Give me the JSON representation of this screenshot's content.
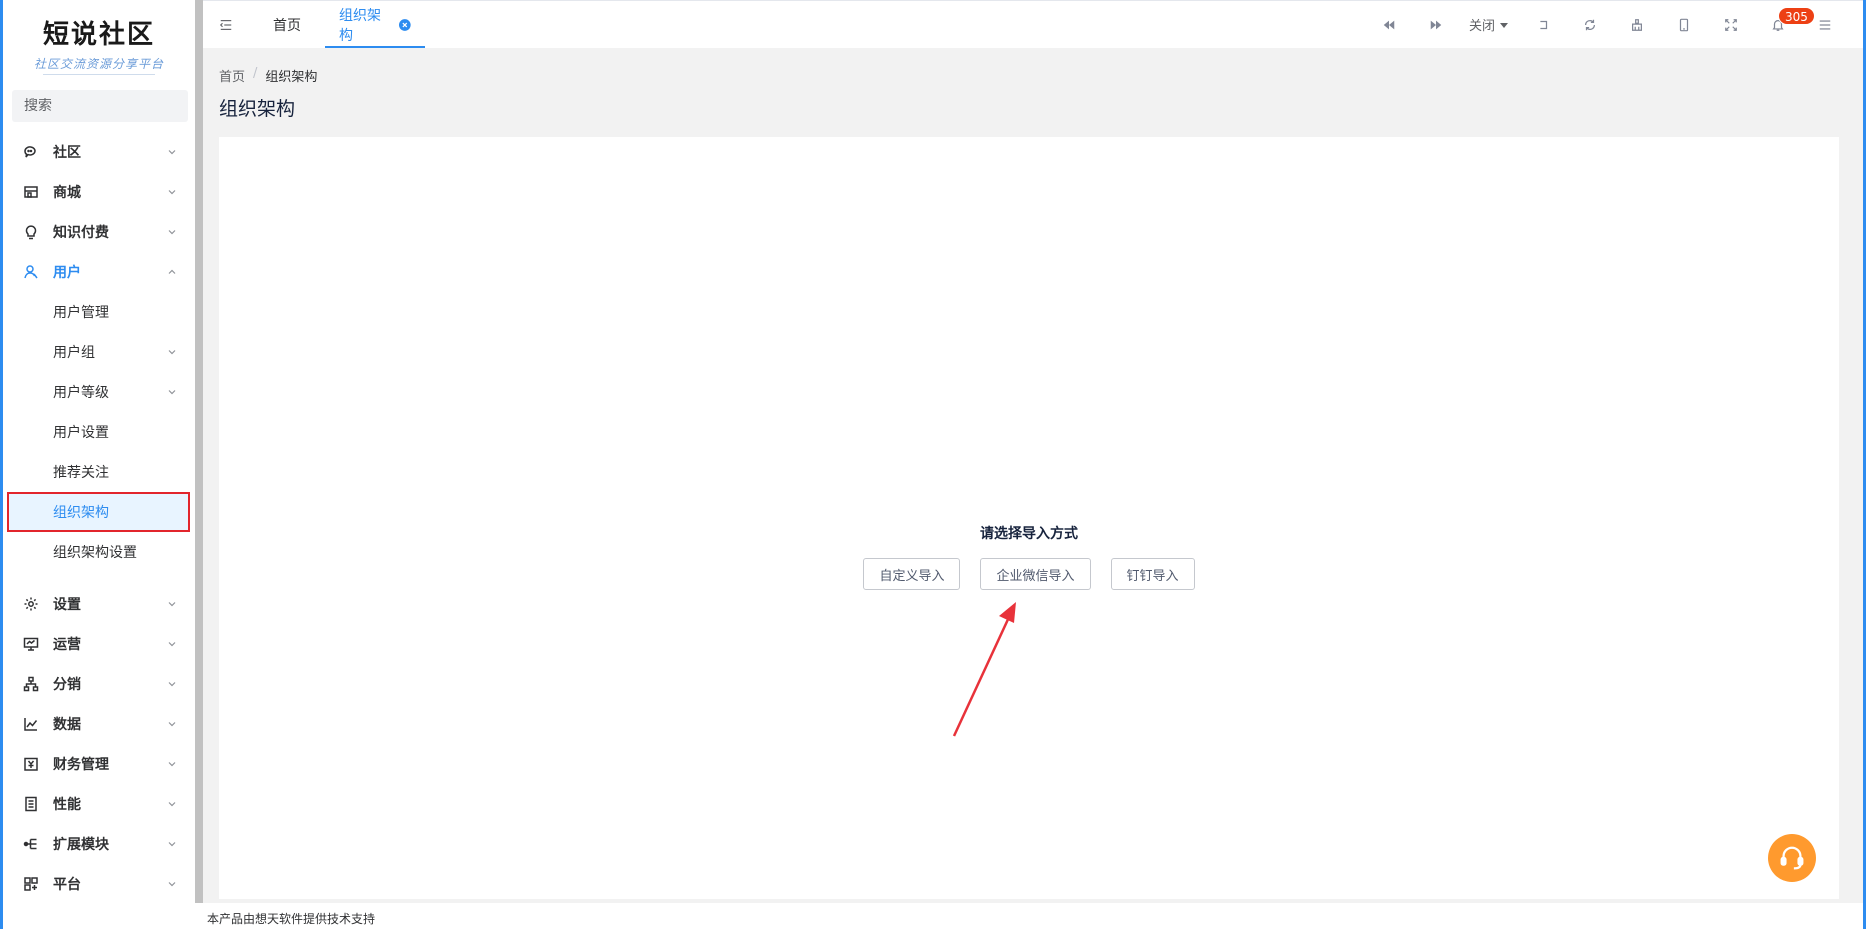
{
  "brand": {
    "title": "短说社区",
    "subtitle": "社区交流资源分享平台"
  },
  "search": {
    "placeholder": "搜索"
  },
  "sidebar": {
    "groups_top": [
      {
        "label": "社区",
        "icon": "chat-icon",
        "expanded": false
      },
      {
        "label": "商城",
        "icon": "store-icon",
        "expanded": false
      },
      {
        "label": "知识付费",
        "icon": "bulb-icon",
        "expanded": false
      },
      {
        "label": "用户",
        "icon": "user-icon",
        "expanded": true
      }
    ],
    "user_submenu": [
      {
        "label": "用户管理",
        "has_children": false
      },
      {
        "label": "用户组",
        "has_children": true
      },
      {
        "label": "用户等级",
        "has_children": true
      },
      {
        "label": "用户设置",
        "has_children": false
      },
      {
        "label": "推荐关注",
        "has_children": false
      },
      {
        "label": "组织架构",
        "has_children": false,
        "selected": true
      },
      {
        "label": "组织架构设置",
        "has_children": false
      }
    ],
    "groups_bottom": [
      {
        "label": "设置",
        "icon": "gear-icon"
      },
      {
        "label": "运营",
        "icon": "monitor-icon"
      },
      {
        "label": "分销",
        "icon": "tree-icon"
      },
      {
        "label": "数据",
        "icon": "chart-icon"
      },
      {
        "label": "财务管理",
        "icon": "finance-icon"
      },
      {
        "label": "性能",
        "icon": "performance-icon"
      },
      {
        "label": "扩展模块",
        "icon": "extension-icon"
      },
      {
        "label": "平台",
        "icon": "platform-icon"
      }
    ]
  },
  "tabs": [
    {
      "label": "首页",
      "active": false
    },
    {
      "label": "组织架构",
      "active": true,
      "closable": true
    }
  ],
  "toolbar": {
    "close_label": "关闭",
    "notification_count": "305"
  },
  "breadcrumb": {
    "home": "首页",
    "separator": "/",
    "current": "组织架构"
  },
  "page": {
    "title": "组织架构",
    "prompt": "请选择导入方式",
    "buttons": [
      "自定义导入",
      "企业微信导入",
      "钉钉导入"
    ]
  },
  "footer": {
    "text": "本产品由想天软件提供技术支持"
  },
  "colors": {
    "accent": "#2d8cf0",
    "highlight_box": "#e2252c",
    "badge": "#ed4014",
    "support": "#ff9a2e"
  }
}
